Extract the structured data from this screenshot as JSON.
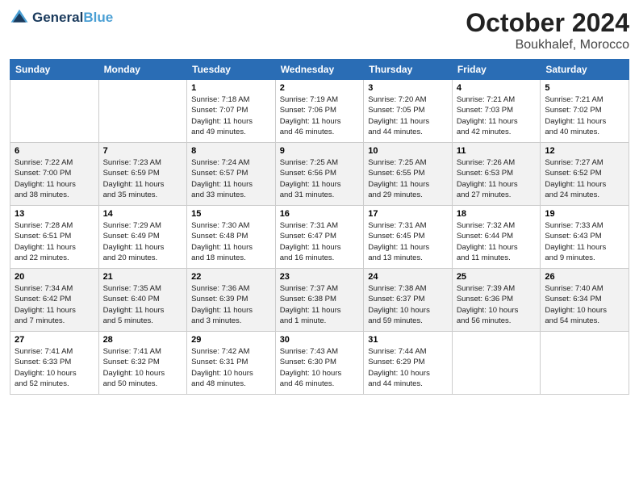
{
  "header": {
    "logo_line1": "General",
    "logo_line2": "Blue",
    "month": "October 2024",
    "location": "Boukhalef, Morocco"
  },
  "days_of_week": [
    "Sunday",
    "Monday",
    "Tuesday",
    "Wednesday",
    "Thursday",
    "Friday",
    "Saturday"
  ],
  "weeks": [
    [
      {
        "day": "",
        "info": ""
      },
      {
        "day": "",
        "info": ""
      },
      {
        "day": "1",
        "info": "Sunrise: 7:18 AM\nSunset: 7:07 PM\nDaylight: 11 hours\nand 49 minutes."
      },
      {
        "day": "2",
        "info": "Sunrise: 7:19 AM\nSunset: 7:06 PM\nDaylight: 11 hours\nand 46 minutes."
      },
      {
        "day": "3",
        "info": "Sunrise: 7:20 AM\nSunset: 7:05 PM\nDaylight: 11 hours\nand 44 minutes."
      },
      {
        "day": "4",
        "info": "Sunrise: 7:21 AM\nSunset: 7:03 PM\nDaylight: 11 hours\nand 42 minutes."
      },
      {
        "day": "5",
        "info": "Sunrise: 7:21 AM\nSunset: 7:02 PM\nDaylight: 11 hours\nand 40 minutes."
      }
    ],
    [
      {
        "day": "6",
        "info": "Sunrise: 7:22 AM\nSunset: 7:00 PM\nDaylight: 11 hours\nand 38 minutes."
      },
      {
        "day": "7",
        "info": "Sunrise: 7:23 AM\nSunset: 6:59 PM\nDaylight: 11 hours\nand 35 minutes."
      },
      {
        "day": "8",
        "info": "Sunrise: 7:24 AM\nSunset: 6:57 PM\nDaylight: 11 hours\nand 33 minutes."
      },
      {
        "day": "9",
        "info": "Sunrise: 7:25 AM\nSunset: 6:56 PM\nDaylight: 11 hours\nand 31 minutes."
      },
      {
        "day": "10",
        "info": "Sunrise: 7:25 AM\nSunset: 6:55 PM\nDaylight: 11 hours\nand 29 minutes."
      },
      {
        "day": "11",
        "info": "Sunrise: 7:26 AM\nSunset: 6:53 PM\nDaylight: 11 hours\nand 27 minutes."
      },
      {
        "day": "12",
        "info": "Sunrise: 7:27 AM\nSunset: 6:52 PM\nDaylight: 11 hours\nand 24 minutes."
      }
    ],
    [
      {
        "day": "13",
        "info": "Sunrise: 7:28 AM\nSunset: 6:51 PM\nDaylight: 11 hours\nand 22 minutes."
      },
      {
        "day": "14",
        "info": "Sunrise: 7:29 AM\nSunset: 6:49 PM\nDaylight: 11 hours\nand 20 minutes."
      },
      {
        "day": "15",
        "info": "Sunrise: 7:30 AM\nSunset: 6:48 PM\nDaylight: 11 hours\nand 18 minutes."
      },
      {
        "day": "16",
        "info": "Sunrise: 7:31 AM\nSunset: 6:47 PM\nDaylight: 11 hours\nand 16 minutes."
      },
      {
        "day": "17",
        "info": "Sunrise: 7:31 AM\nSunset: 6:45 PM\nDaylight: 11 hours\nand 13 minutes."
      },
      {
        "day": "18",
        "info": "Sunrise: 7:32 AM\nSunset: 6:44 PM\nDaylight: 11 hours\nand 11 minutes."
      },
      {
        "day": "19",
        "info": "Sunrise: 7:33 AM\nSunset: 6:43 PM\nDaylight: 11 hours\nand 9 minutes."
      }
    ],
    [
      {
        "day": "20",
        "info": "Sunrise: 7:34 AM\nSunset: 6:42 PM\nDaylight: 11 hours\nand 7 minutes."
      },
      {
        "day": "21",
        "info": "Sunrise: 7:35 AM\nSunset: 6:40 PM\nDaylight: 11 hours\nand 5 minutes."
      },
      {
        "day": "22",
        "info": "Sunrise: 7:36 AM\nSunset: 6:39 PM\nDaylight: 11 hours\nand 3 minutes."
      },
      {
        "day": "23",
        "info": "Sunrise: 7:37 AM\nSunset: 6:38 PM\nDaylight: 11 hours\nand 1 minute."
      },
      {
        "day": "24",
        "info": "Sunrise: 7:38 AM\nSunset: 6:37 PM\nDaylight: 10 hours\nand 59 minutes."
      },
      {
        "day": "25",
        "info": "Sunrise: 7:39 AM\nSunset: 6:36 PM\nDaylight: 10 hours\nand 56 minutes."
      },
      {
        "day": "26",
        "info": "Sunrise: 7:40 AM\nSunset: 6:34 PM\nDaylight: 10 hours\nand 54 minutes."
      }
    ],
    [
      {
        "day": "27",
        "info": "Sunrise: 7:41 AM\nSunset: 6:33 PM\nDaylight: 10 hours\nand 52 minutes."
      },
      {
        "day": "28",
        "info": "Sunrise: 7:41 AM\nSunset: 6:32 PM\nDaylight: 10 hours\nand 50 minutes."
      },
      {
        "day": "29",
        "info": "Sunrise: 7:42 AM\nSunset: 6:31 PM\nDaylight: 10 hours\nand 48 minutes."
      },
      {
        "day": "30",
        "info": "Sunrise: 7:43 AM\nSunset: 6:30 PM\nDaylight: 10 hours\nand 46 minutes."
      },
      {
        "day": "31",
        "info": "Sunrise: 7:44 AM\nSunset: 6:29 PM\nDaylight: 10 hours\nand 44 minutes."
      },
      {
        "day": "",
        "info": ""
      },
      {
        "day": "",
        "info": ""
      }
    ]
  ]
}
